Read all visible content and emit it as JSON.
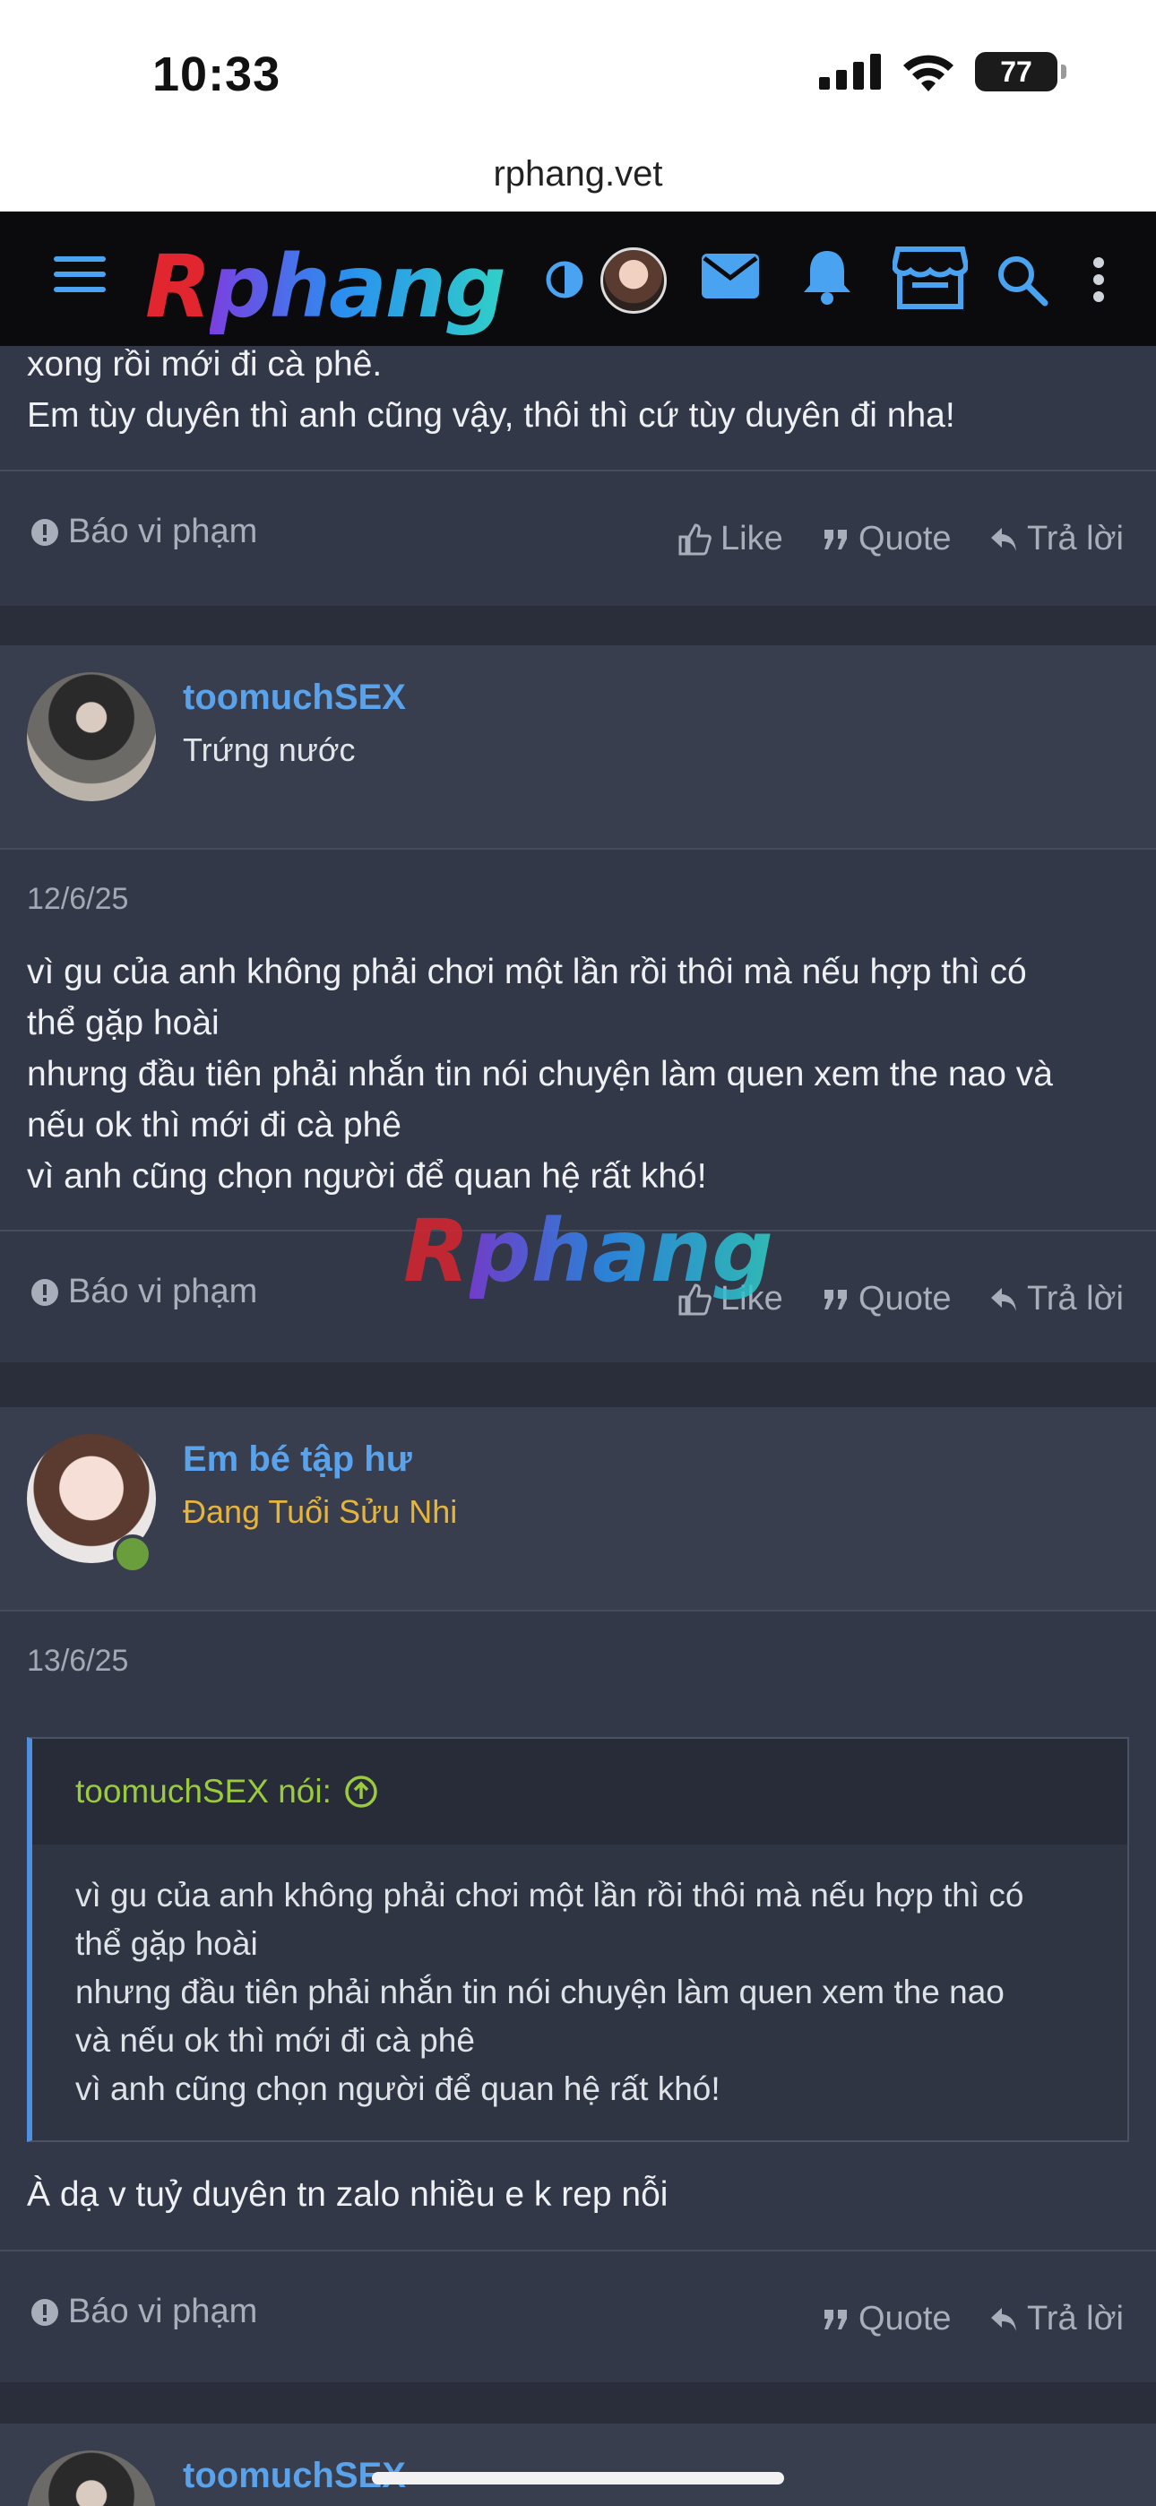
{
  "status": {
    "time": "10:33",
    "battery": "77"
  },
  "browser": {
    "url": "rphang.vet"
  },
  "header": {
    "logo_first": "R",
    "logo_rest": "phang",
    "icons": [
      "menu-icon",
      "theme-toggle-icon",
      "avatar",
      "mail-icon",
      "bell-icon",
      "store-icon",
      "search-icon",
      "more-vertical-icon"
    ]
  },
  "post0": {
    "lines": [
      "xong rồi mới đi cà phê.",
      "Em tùy duyên thì anh cũng vậy, thôi thì cứ tùy duyên đi nha!"
    ],
    "report": "Báo vi phạm",
    "like": "Like",
    "quote": "Quote",
    "reply": "Trả lời"
  },
  "post1": {
    "username": "toomuchSEX",
    "user_title": "Trứng nước",
    "date": "12/6/25",
    "lines": [
      "vì gu của anh không phải chơi một lần rồi thôi mà nếu hợp thì có",
      "thể gặp hoài",
      "nhưng đầu tiên phải nhắn tin nói chuyện làm quen xem the nao và",
      "nếu ok thì mới đi cà phê",
      "vì anh cũng chọn người để quan hệ rất khó!"
    ],
    "report": "Báo vi phạm",
    "like": "Like",
    "quote": "Quote",
    "reply": "Trả lời"
  },
  "watermark": {
    "first": "R",
    "rest": "phang"
  },
  "post2": {
    "username": "Em bé tập hư",
    "user_title": "Đang Tuổi Sửu Nhi",
    "date": "13/6/25",
    "quote_author": "toomuchSEX nói:",
    "quote_lines": [
      "vì gu của anh không phải chơi một lần rồi thôi mà nếu hợp thì có",
      "thể gặp hoài",
      "nhưng đầu tiên phải nhắn tin nói chuyện làm quen xem the nao",
      "và nếu ok thì mới đi cà phê",
      "vì anh cũng chọn người để quan hệ rất khó!"
    ],
    "text": "À dạ v tuỷ duyên tn zalo nhiều e k rep nỗi",
    "report": "Báo vi phạm",
    "quote": "Quote",
    "reply": "Trả lời"
  },
  "post3": {
    "username": "toomuchSEX"
  },
  "colors": {
    "accent": "#5aa2ea",
    "quote_author": "#9acb3d",
    "title_gold": "#e7b43b",
    "online": "#6a9d3b"
  }
}
